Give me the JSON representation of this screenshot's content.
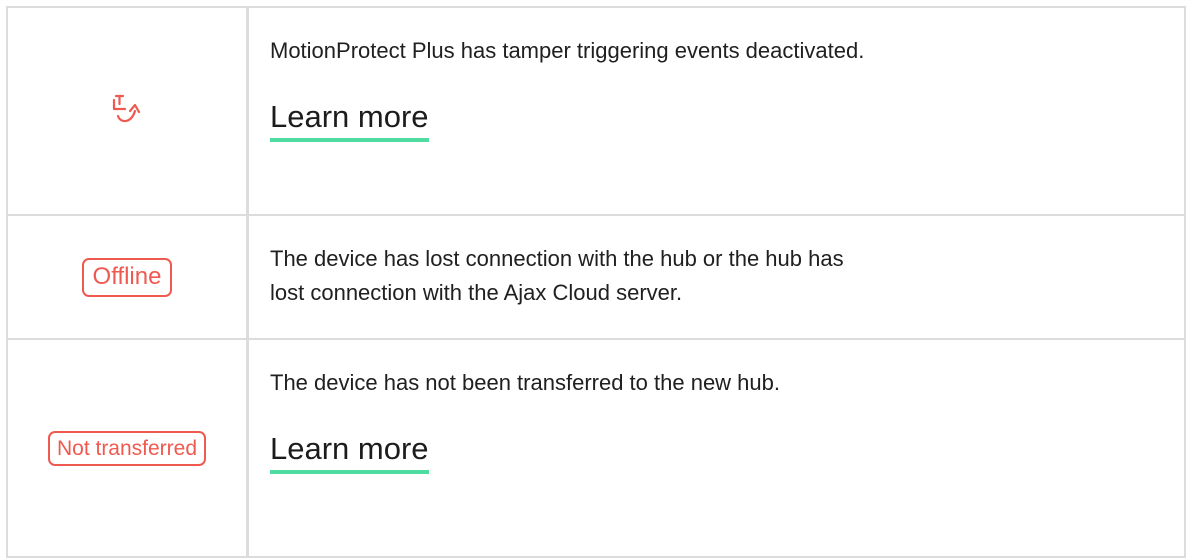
{
  "rows": [
    {
      "icon": "tamper-deactivated-icon",
      "description": "MotionProtect Plus has tamper triggering events deactivated.",
      "link": "Learn more"
    },
    {
      "badge": "Offline",
      "description": "The device has lost connection with the hub or the hub has lost connection with the Ajax Cloud server."
    },
    {
      "badge": "Not transferred",
      "description": "The device has not been transferred to the new hub.",
      "link": "Learn more"
    }
  ],
  "colors": {
    "accent_red": "#ef5a50",
    "link_underline": "#4fdca0",
    "border": "#dcdcdc"
  }
}
